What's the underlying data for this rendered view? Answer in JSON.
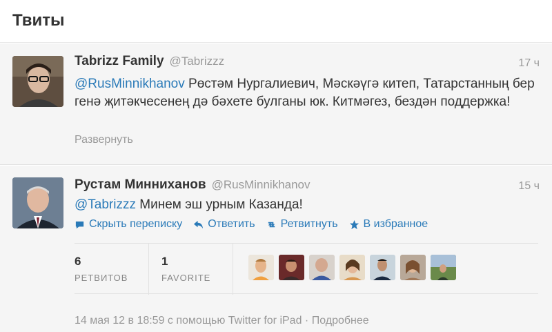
{
  "header": {
    "title": "Твиты"
  },
  "tweets": [
    {
      "name": "Tabrizz Family",
      "screen_name": "@Tabrizzz",
      "time": "17 ч",
      "mention": "@RusMinnikhanov",
      "text": " Рөстәм Нургалиевич, Мәскәүгә китеп, Татарстанның бер генә җитәкчесенең дә бәхете булганы юк. Китмәгез, бездән поддержка!",
      "expand_label": "Развернуть"
    },
    {
      "name": "Рустам Минниханов",
      "screen_name": "@RusMinnikhanov",
      "time": "15 ч",
      "mention": "@Tabrizzz",
      "text": " Минем эш урным Казанда!",
      "actions": {
        "hide": "Скрыть переписку",
        "reply": "Ответить",
        "retweet": "Ретвитнуть",
        "favorite": "В избранное"
      },
      "stats": {
        "retweets_count": "6",
        "retweets_label": "РЕТВИТОВ",
        "favorites_count": "1",
        "favorites_label": "FAVORITE"
      },
      "meta": "14 мая 12 в 18:59 с помощью Twitter for iPad · Подробнее"
    }
  ],
  "colors": {
    "link": "#2a7ab8",
    "muted": "#999999",
    "text": "#333333",
    "tweet_bg": "#f5f5f5"
  },
  "icons": [
    "conversation-icon",
    "reply-icon",
    "retweet-icon",
    "star-icon"
  ]
}
